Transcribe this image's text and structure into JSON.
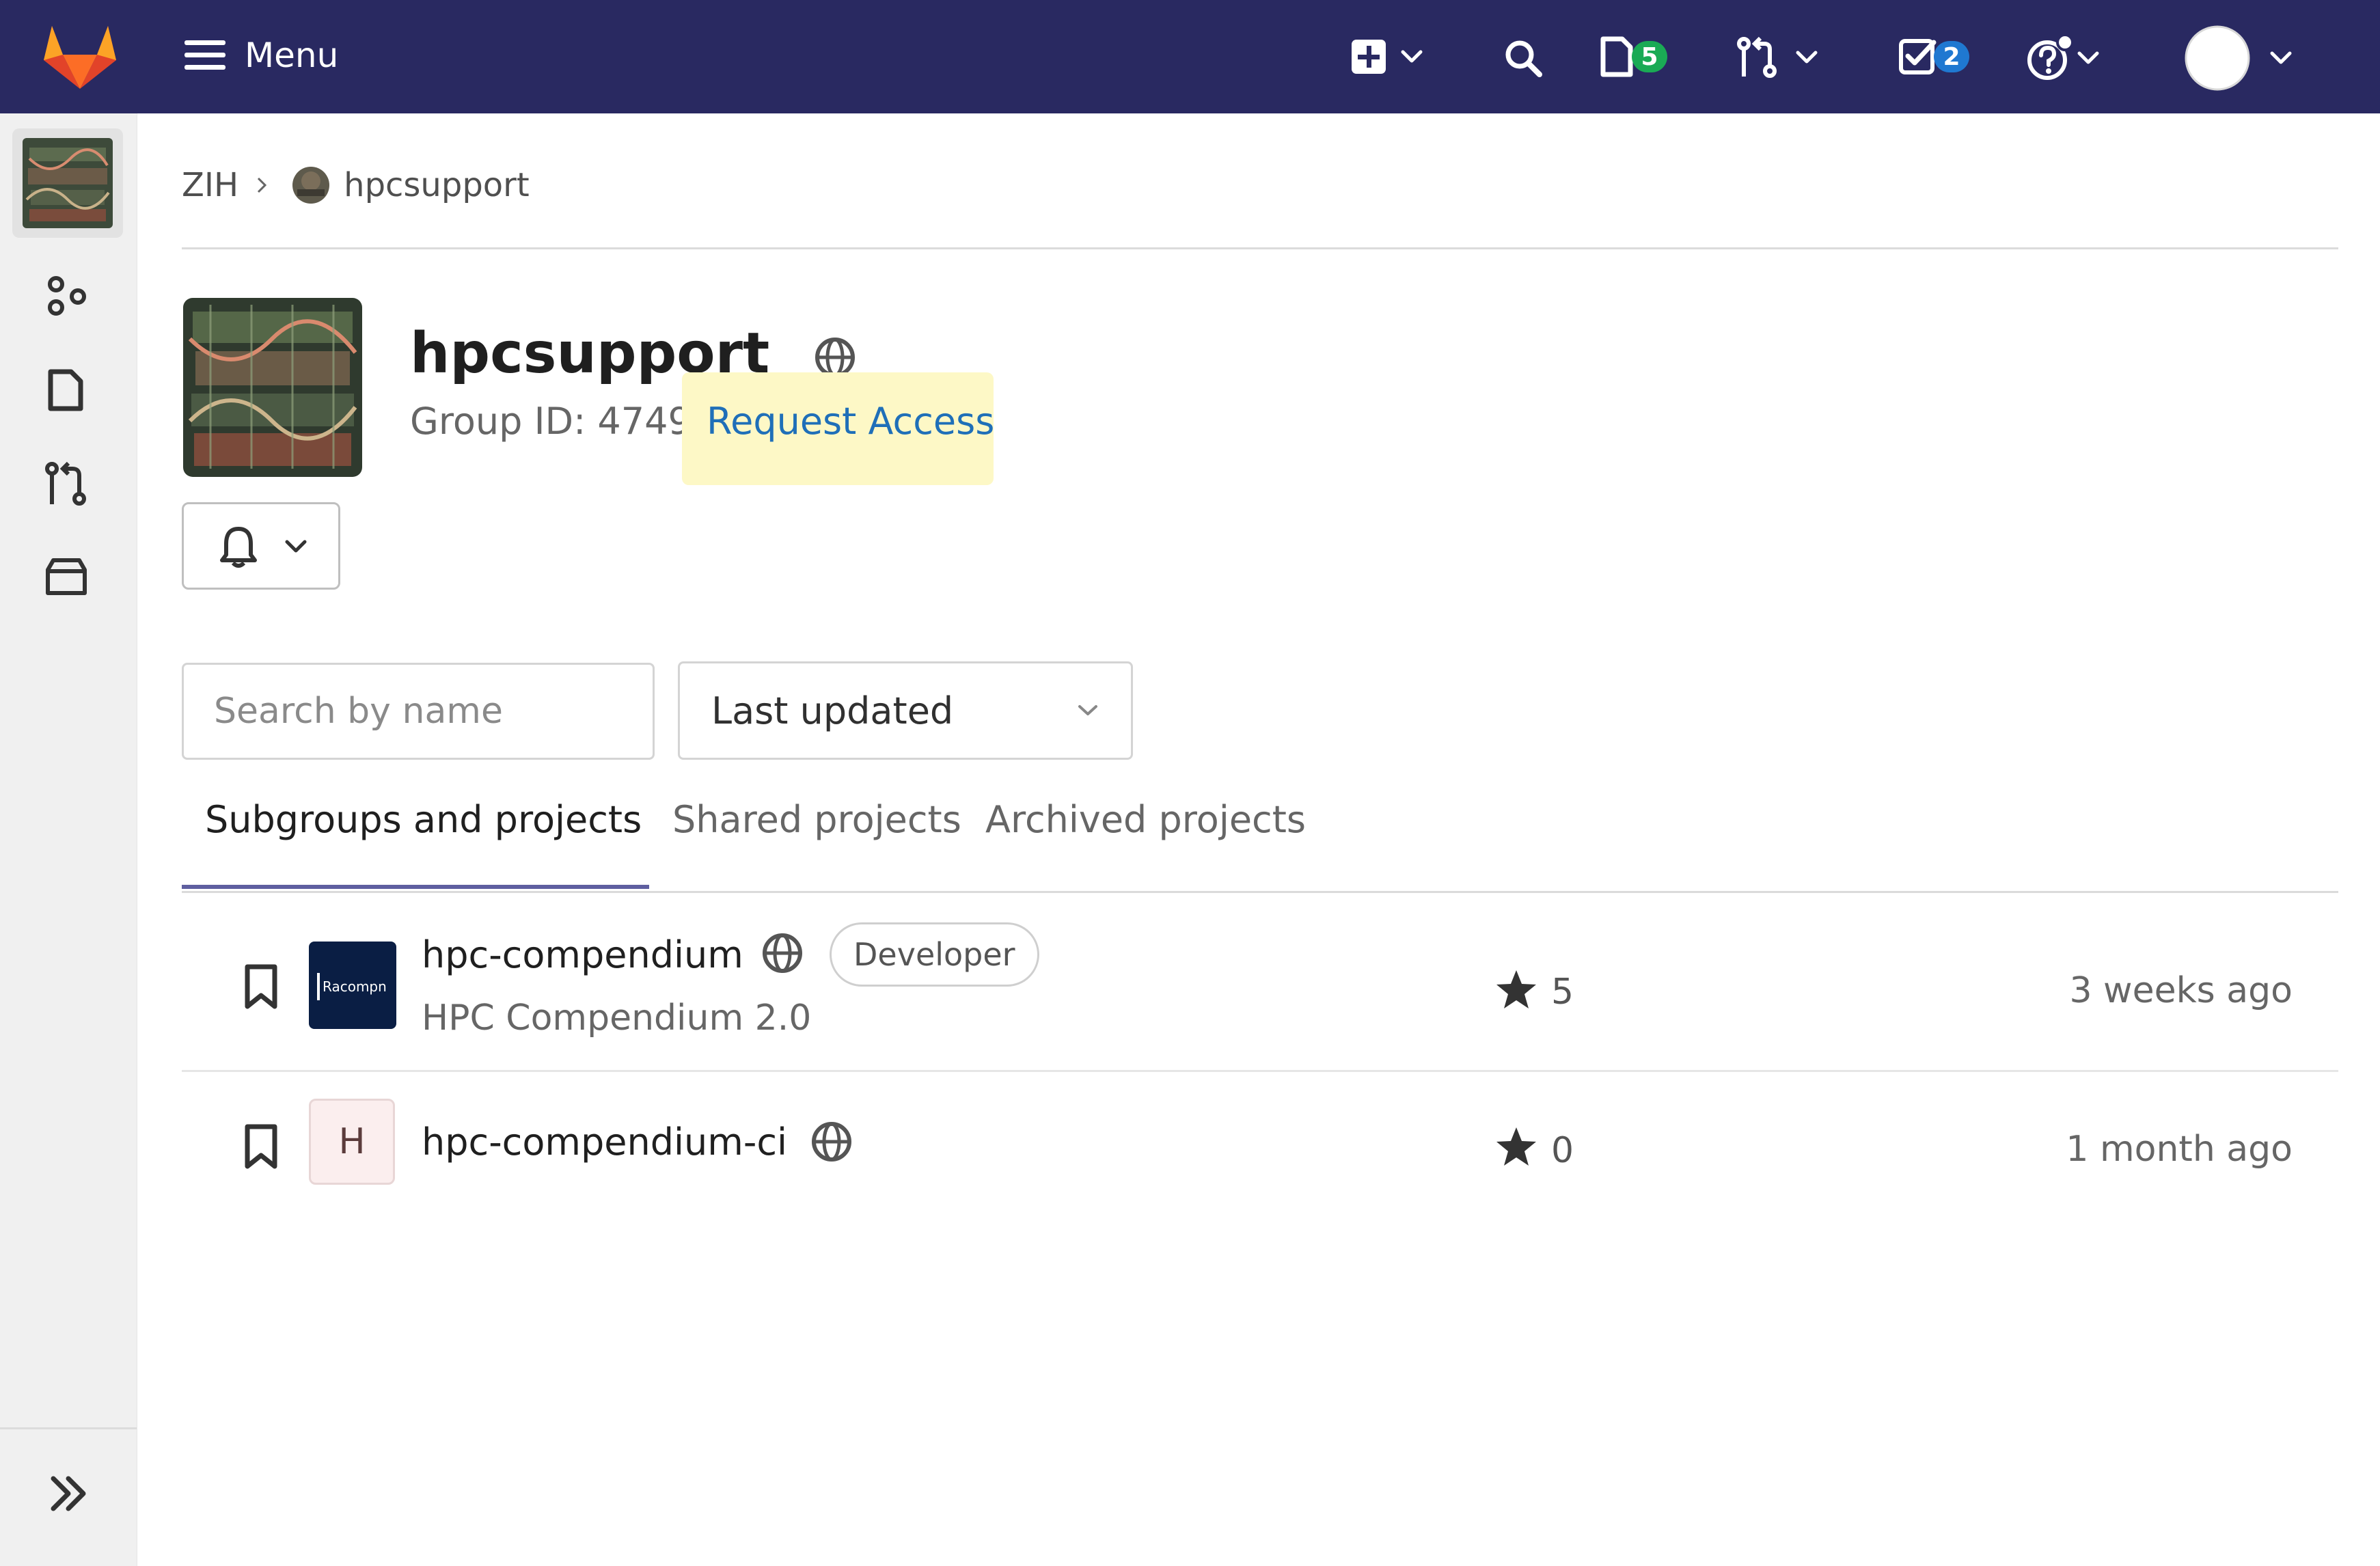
{
  "colors": {
    "navbar_bg": "#292961",
    "issues_badge": "#1aaa55",
    "todos_badge": "#1f78d1",
    "link": "#1f6fb8",
    "highlight": "#fdf8c6"
  },
  "navbar": {
    "menu_label": "Menu",
    "issues_count": "5",
    "todos_count": "2",
    "icons": [
      "gitlab-logo",
      "hamburger-icon",
      "plus-square-icon",
      "search-icon",
      "issues-icon",
      "merge-request-icon",
      "todo-icon",
      "help-icon",
      "user-avatar"
    ]
  },
  "breadcrumb": {
    "parent": "ZIH",
    "current": "hpcsupport"
  },
  "group": {
    "name": "hpcsupport",
    "group_id_text": "Group ID: 4749",
    "request_access": "Request Access"
  },
  "filters": {
    "search_placeholder": "Search by name",
    "sort_selected": "Last updated"
  },
  "tabs": [
    {
      "label": "Subgroups and projects",
      "active": true
    },
    {
      "label": "Shared projects",
      "active": false
    },
    {
      "label": "Archived projects",
      "active": false
    }
  ],
  "projects": [
    {
      "name": "hpc-compendium",
      "description": "HPC Compendium 2.0",
      "role": "Developer",
      "stars": "5",
      "updated": "3 weeks ago",
      "avatar_letter": ""
    },
    {
      "name": "hpc-compendium-ci",
      "description": "",
      "role": "",
      "stars": "0",
      "updated": "1 month ago",
      "avatar_letter": "H"
    }
  ]
}
